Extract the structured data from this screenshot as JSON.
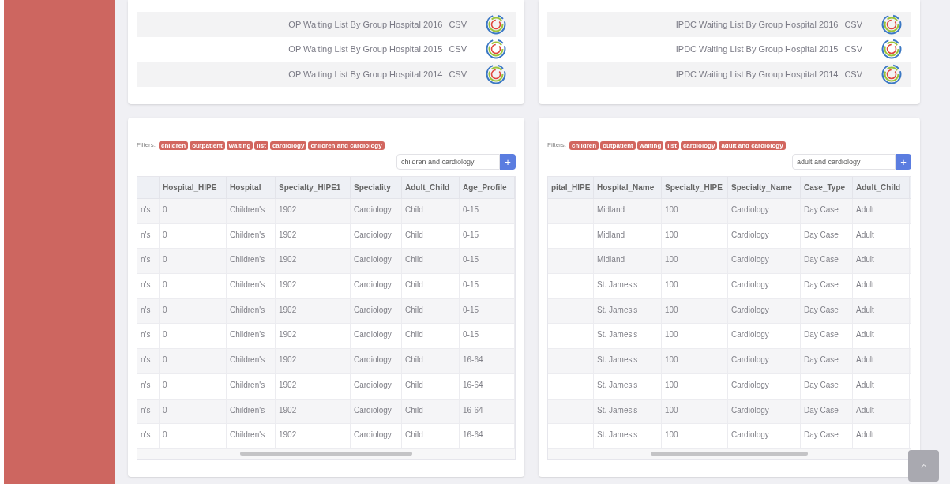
{
  "datasets": [
    {
      "files": [
        {
          "title": "OP Waiting List By Group Hospital 2016",
          "format": "CSV"
        },
        {
          "title": "OP Waiting List By Group Hospital 2015",
          "format": "CSV"
        },
        {
          "title": "OP Waiting List By Group Hospital 2014",
          "format": "CSV"
        }
      ]
    },
    {
      "files": [
        {
          "title": "IPDC Waiting List By Group Hospital 2016",
          "format": "CSV"
        },
        {
          "title": "IPDC Waiting List By Group Hospital 2015",
          "format": "CSV"
        },
        {
          "title": "IPDC Waiting List By Group Hospital 2014",
          "format": "CSV"
        }
      ]
    }
  ],
  "tables": [
    {
      "filters_label": "Filters:",
      "filters": [
        "children",
        "outpatient",
        "waiting",
        "list",
        "cardiology",
        "children and cardiology"
      ],
      "search": {
        "value": "children and cardiology",
        "button": "+"
      },
      "columns": [
        {},
        {
          "label": "Hospital_HIPE"
        },
        {
          "label": "Hospital"
        },
        {
          "label": "Specialty_HIPE1"
        },
        {
          "label": "Speciality"
        },
        {
          "label": "Adult_Child"
        },
        {
          "label": "Age_Profile"
        }
      ],
      "rows": [
        [
          "n's",
          "0",
          "Children's",
          "1902",
          "Cardiology",
          "Child",
          "0-15"
        ],
        [
          "n's",
          "0",
          "Children's",
          "1902",
          "Cardiology",
          "Child",
          "0-15"
        ],
        [
          "n's",
          "0",
          "Children's",
          "1902",
          "Cardiology",
          "Child",
          "0-15"
        ],
        [
          "n's",
          "0",
          "Children's",
          "1902",
          "Cardiology",
          "Child",
          "0-15"
        ],
        [
          "n's",
          "0",
          "Children's",
          "1902",
          "Cardiology",
          "Child",
          "0-15"
        ],
        [
          "n's",
          "0",
          "Children's",
          "1902",
          "Cardiology",
          "Child",
          "0-15"
        ],
        [
          "n's",
          "0",
          "Children's",
          "1902",
          "Cardiology",
          "Child",
          "16-64"
        ],
        [
          "n's",
          "0",
          "Children's",
          "1902",
          "Cardiology",
          "Child",
          "16-64"
        ],
        [
          "n's",
          "0",
          "Children's",
          "1902",
          "Cardiology",
          "Child",
          "16-64"
        ],
        [
          "n's",
          "0",
          "Children's",
          "1902",
          "Cardiology",
          "Child",
          "16-64"
        ]
      ]
    },
    {
      "filters_label": "Filters:",
      "filters": [
        "children",
        "outpatient",
        "waiting",
        "list",
        "cardiology",
        "adult and cardiology"
      ],
      "search": {
        "value": "adult and cardiology",
        "button": "+"
      },
      "columns": [
        {
          "label": "pital_HIPE"
        },
        {
          "label": "Hospital_Name"
        },
        {
          "label": "Specialty_HIPE"
        },
        {
          "label": "Specialty_Name"
        },
        {
          "label": "Case_Type"
        },
        {
          "label": "Adult_Child"
        }
      ],
      "rows": [
        [
          null,
          "Midland",
          "100",
          "Cardiology",
          "Day Case",
          "Adult"
        ],
        [
          null,
          "Midland",
          "100",
          "Cardiology",
          "Day Case",
          "Adult"
        ],
        [
          null,
          "Midland",
          "100",
          "Cardiology",
          "Day Case",
          "Adult"
        ],
        [
          null,
          "St. James's",
          "100",
          "Cardiology",
          "Day Case",
          "Adult"
        ],
        [
          null,
          "St. James's",
          "100",
          "Cardiology",
          "Day Case",
          "Adult"
        ],
        [
          null,
          "St. James's",
          "100",
          "Cardiology",
          "Day Case",
          "Adult"
        ],
        [
          null,
          "St. James's",
          "100",
          "Cardiology",
          "Day Case",
          "Adult"
        ],
        [
          null,
          "St. James's",
          "100",
          "Cardiology",
          "Day Case",
          "Adult"
        ],
        [
          null,
          "St. James's",
          "100",
          "Cardiology",
          "Day Case",
          "Adult"
        ],
        [
          null,
          "St. James's",
          "100",
          "Cardiology",
          "Day Case",
          "Adult"
        ]
      ]
    }
  ]
}
